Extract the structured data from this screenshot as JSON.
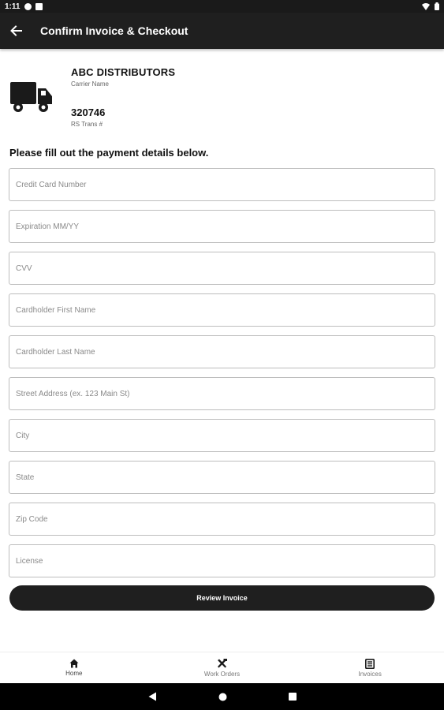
{
  "status_bar": {
    "time": "1:11",
    "icons": [
      "notification-icon",
      "sim-icon",
      "wifi-icon",
      "battery-icon"
    ]
  },
  "app_bar": {
    "title": "Confirm Invoice & Checkout",
    "back_icon": "arrow-left-icon"
  },
  "carrier": {
    "icon": "truck-icon",
    "name": "ABC DISTRIBUTORS",
    "name_label": "Carrier Name",
    "trans_number": "320746",
    "trans_label": "RS Trans #"
  },
  "form": {
    "instructions": "Please fill out the payment details below.",
    "fields": [
      {
        "placeholder": "Credit Card Number",
        "value": ""
      },
      {
        "placeholder": "Expiration MM/YY",
        "value": ""
      },
      {
        "placeholder": "CVV",
        "value": ""
      },
      {
        "placeholder": "Cardholder First Name",
        "value": ""
      },
      {
        "placeholder": "Cardholder Last Name",
        "value": ""
      },
      {
        "placeholder": "Street Address (ex. 123 Main St)",
        "value": ""
      },
      {
        "placeholder": "City",
        "value": ""
      },
      {
        "placeholder": "State",
        "value": ""
      },
      {
        "placeholder": "Zip Code",
        "value": ""
      },
      {
        "placeholder": "License",
        "value": ""
      }
    ],
    "submit_label": "Review Invoice"
  },
  "bottom_nav": {
    "items": [
      {
        "label": "Home",
        "icon": "home-icon"
      },
      {
        "label": "Work Orders",
        "icon": "tools-icon"
      },
      {
        "label": "Invoices",
        "icon": "invoice-icon"
      }
    ]
  },
  "colors": {
    "app_bar": "#1f1f1f",
    "button": "#1f1f1f",
    "field_border": "#bdbdbd"
  }
}
